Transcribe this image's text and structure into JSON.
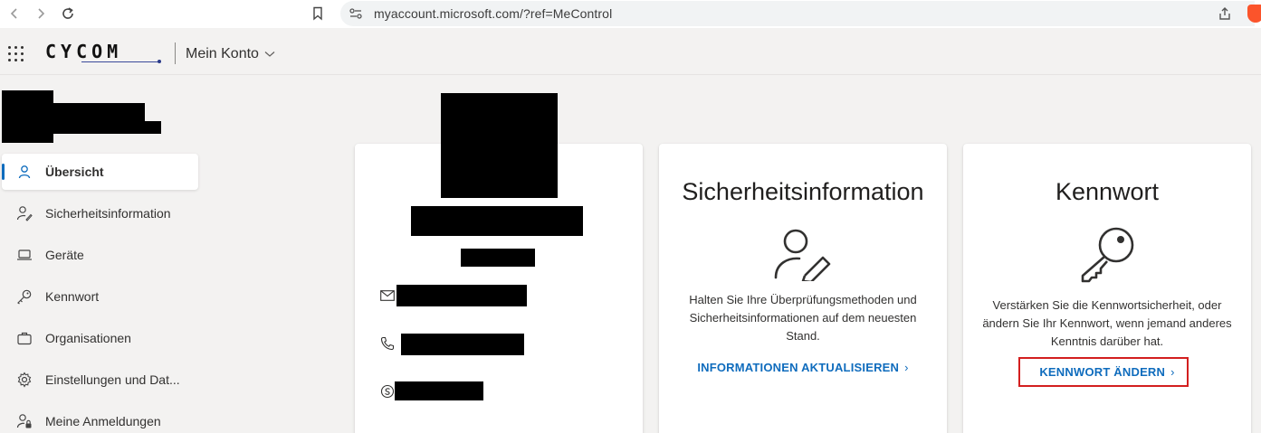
{
  "browser": {
    "url": "myaccount.microsoft.com/?ref=MeControl",
    "icons": [
      "back-icon",
      "forward-icon",
      "reload-icon",
      "bookmark-icon",
      "site-settings-icon",
      "share-icon",
      "brave-icon"
    ]
  },
  "header": {
    "logo": "CYCOM",
    "title": "Mein Konto"
  },
  "sidebar": {
    "items": [
      {
        "label": "Übersicht",
        "icon": "person-icon",
        "active": true
      },
      {
        "label": "Sicherheitsinformation",
        "icon": "person-edit-icon",
        "active": false
      },
      {
        "label": "Geräte",
        "icon": "laptop-icon",
        "active": false
      },
      {
        "label": "Kennwort",
        "icon": "key-icon",
        "active": false
      },
      {
        "label": "Organisationen",
        "icon": "briefcase-icon",
        "active": false
      },
      {
        "label": "Einstellungen und Dat...",
        "icon": "gear-icon",
        "active": false
      },
      {
        "label": "Meine Anmeldungen",
        "icon": "person-lock-icon",
        "active": false
      }
    ]
  },
  "cards": {
    "security": {
      "title": "Sicherheitsinformation",
      "description": "Halten Sie Ihre Überprüfungsmethoden und Sicherheitsinformationen auf dem neuesten Stand.",
      "link": "INFORMATIONEN AKTUALISIEREN"
    },
    "password": {
      "title": "Kennwort",
      "description": "Verstärken Sie die Kennwortsicherheit, oder ändern Sie Ihr Kennwort, wenn jemand anderes Kenntnis darüber hat.",
      "link": "KENNWORT ÄNDERN"
    }
  },
  "colors": {
    "accent": "#0f6cbd",
    "highlight": "#d31f1f",
    "background": "#f3f2f1"
  }
}
